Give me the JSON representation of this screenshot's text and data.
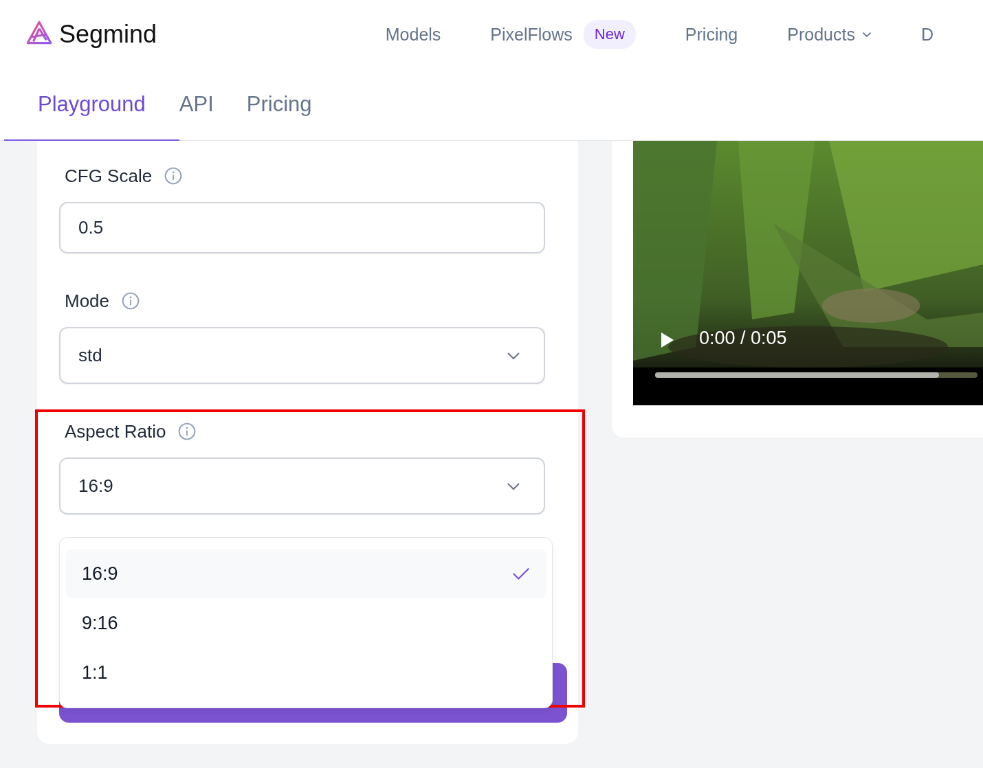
{
  "brand": {
    "name": "Segmind"
  },
  "nav": [
    {
      "label": "Models",
      "kind": "link"
    },
    {
      "label": "PixelFlows",
      "kind": "link",
      "badge": "New"
    },
    {
      "label": "Pricing",
      "kind": "link"
    },
    {
      "label": "Products",
      "kind": "menu"
    },
    {
      "label": "D",
      "kind": "link"
    }
  ],
  "tabs": [
    {
      "label": "Playground",
      "selected": true
    },
    {
      "label": "API",
      "selected": false
    },
    {
      "label": "Pricing",
      "selected": false
    }
  ],
  "fields": [
    {
      "label": "CFG Scale",
      "kind": "input",
      "value": "0.5"
    },
    {
      "label": "Mode",
      "kind": "select",
      "value": "std"
    },
    {
      "label": "Aspect Ratio",
      "kind": "select",
      "value": "16:9",
      "expanded": true,
      "options": [
        {
          "label": "16:9",
          "selected": true
        },
        {
          "label": "9:16",
          "selected": false
        },
        {
          "label": "1:1",
          "selected": false
        }
      ]
    }
  ],
  "video": {
    "time": "0:00 / 0:05",
    "level": 0.88
  }
}
